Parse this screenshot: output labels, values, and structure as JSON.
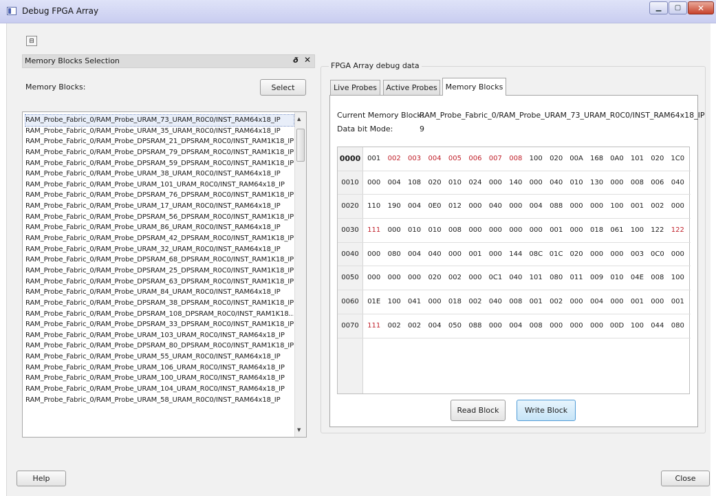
{
  "window": {
    "title": "Debug FPGA Array",
    "minimize_glyph": "▁",
    "maximize_glyph": "▢",
    "close_glyph": "✕"
  },
  "toolbar": {
    "toggle_glyph": "⊟"
  },
  "memory_selection": {
    "dock_title": "Memory Blocks Selection",
    "float_glyph": "ð",
    "close_glyph": "✕",
    "label": "Memory Blocks:",
    "select_button": "Select",
    "selected_index": 0,
    "items": [
      "RAM_Probe_Fabric_0/RAM_Probe_URAM_73_URAM_R0C0/INST_RAM64x18_IP",
      "RAM_Probe_Fabric_0/RAM_Probe_URAM_35_URAM_R0C0/INST_RAM64x18_IP",
      "RAM_Probe_Fabric_0/RAM_Probe_DPSRAM_21_DPSRAM_R0C0/INST_RAM1K18_IP",
      "RAM_Probe_Fabric_0/RAM_Probe_DPSRAM_79_DPSRAM_R0C0/INST_RAM1K18_IP",
      "RAM_Probe_Fabric_0/RAM_Probe_DPSRAM_59_DPSRAM_R0C0/INST_RAM1K18_IP",
      "RAM_Probe_Fabric_0/RAM_Probe_URAM_38_URAM_R0C0/INST_RAM64x18_IP",
      "RAM_Probe_Fabric_0/RAM_Probe_URAM_101_URAM_R0C0/INST_RAM64x18_IP",
      "RAM_Probe_Fabric_0/RAM_Probe_DPSRAM_76_DPSRAM_R0C0/INST_RAM1K18_IP",
      "RAM_Probe_Fabric_0/RAM_Probe_URAM_17_URAM_R0C0/INST_RAM64x18_IP",
      "RAM_Probe_Fabric_0/RAM_Probe_DPSRAM_56_DPSRAM_R0C0/INST_RAM1K18_IP",
      "RAM_Probe_Fabric_0/RAM_Probe_URAM_86_URAM_R0C0/INST_RAM64x18_IP",
      "RAM_Probe_Fabric_0/RAM_Probe_DPSRAM_42_DPSRAM_R0C0/INST_RAM1K18_IP",
      "RAM_Probe_Fabric_0/RAM_Probe_URAM_32_URAM_R0C0/INST_RAM64x18_IP",
      "RAM_Probe_Fabric_0/RAM_Probe_DPSRAM_68_DPSRAM_R0C0/INST_RAM1K18_IP",
      "RAM_Probe_Fabric_0/RAM_Probe_DPSRAM_25_DPSRAM_R0C0/INST_RAM1K18_IP",
      "RAM_Probe_Fabric_0/RAM_Probe_DPSRAM_63_DPSRAM_R0C0/INST_RAM1K18_IP",
      "RAM_Probe_Fabric_0/RAM_Probe_URAM_84_URAM_R0C0/INST_RAM64x18_IP",
      "RAM_Probe_Fabric_0/RAM_Probe_DPSRAM_38_DPSRAM_R0C0/INST_RAM1K18_IP",
      "RAM_Probe_Fabric_0/RAM_Probe_DPSRAM_108_DPSRAM_R0C0/INST_RAM1K18...",
      "RAM_Probe_Fabric_0/RAM_Probe_DPSRAM_33_DPSRAM_R0C0/INST_RAM1K18_IP",
      "RAM_Probe_Fabric_0/RAM_Probe_URAM_103_URAM_R0C0/INST_RAM64x18_IP",
      "RAM_Probe_Fabric_0/RAM_Probe_DPSRAM_80_DPSRAM_R0C0/INST_RAM1K18_IP",
      "RAM_Probe_Fabric_0/RAM_Probe_URAM_55_URAM_R0C0/INST_RAM64x18_IP",
      "RAM_Probe_Fabric_0/RAM_Probe_URAM_106_URAM_R0C0/INST_RAM64x18_IP",
      "RAM_Probe_Fabric_0/RAM_Probe_URAM_100_URAM_R0C0/INST_RAM64x18_IP",
      "RAM_Probe_Fabric_0/RAM_Probe_URAM_104_URAM_R0C0/INST_RAM64x18_IP",
      "RAM_Probe_Fabric_0/RAM_Probe_URAM_58_URAM_R0C0/INST_RAM64x18_IP"
    ]
  },
  "debug_data": {
    "group_title": "FPGA Array debug data",
    "tabs": [
      "Live Probes",
      "Active Probes",
      "Memory Blocks"
    ],
    "active_tab": "Memory Blocks",
    "current_block_label": "Current Memory Block:",
    "current_block_value": "RAM_Probe_Fabric_0/RAM_Probe_URAM_73_URAM_R0C0/INST_RAM64x18_IP",
    "data_bit_mode_label": "Data bit Mode:",
    "data_bit_mode_value": "9",
    "highlight_color": "#c0202a",
    "rows": [
      {
        "addr": "0000",
        "addr_bold": true,
        "cells": [
          "001",
          "002",
          "003",
          "004",
          "005",
          "006",
          "007",
          "008",
          "100",
          "020",
          "00A",
          "168",
          "0A0",
          "101",
          "020",
          "1C0"
        ],
        "red": [
          1,
          2,
          3,
          4,
          5,
          6,
          7
        ]
      },
      {
        "addr": "0010",
        "addr_bold": false,
        "cells": [
          "000",
          "004",
          "108",
          "020",
          "010",
          "024",
          "000",
          "140",
          "000",
          "040",
          "010",
          "130",
          "000",
          "008",
          "006",
          "040"
        ],
        "red": []
      },
      {
        "addr": "0020",
        "addr_bold": false,
        "cells": [
          "110",
          "190",
          "004",
          "0E0",
          "012",
          "000",
          "040",
          "000",
          "004",
          "088",
          "000",
          "000",
          "100",
          "001",
          "002",
          "000"
        ],
        "red": []
      },
      {
        "addr": "0030",
        "addr_bold": false,
        "cells": [
          "111",
          "000",
          "010",
          "010",
          "008",
          "000",
          "000",
          "000",
          "000",
          "001",
          "000",
          "018",
          "061",
          "100",
          "122",
          "122"
        ],
        "red": [
          0,
          15
        ]
      },
      {
        "addr": "0040",
        "addr_bold": false,
        "cells": [
          "000",
          "080",
          "004",
          "040",
          "000",
          "001",
          "000",
          "144",
          "08C",
          "01C",
          "020",
          "000",
          "000",
          "003",
          "0C0",
          "000"
        ],
        "red": []
      },
      {
        "addr": "0050",
        "addr_bold": false,
        "cells": [
          "000",
          "000",
          "000",
          "020",
          "002",
          "000",
          "0C1",
          "040",
          "101",
          "080",
          "011",
          "009",
          "010",
          "04E",
          "008",
          "100"
        ],
        "red": []
      },
      {
        "addr": "0060",
        "addr_bold": false,
        "cells": [
          "01E",
          "100",
          "041",
          "000",
          "018",
          "002",
          "040",
          "008",
          "001",
          "002",
          "000",
          "004",
          "000",
          "001",
          "000",
          "001"
        ],
        "red": []
      },
      {
        "addr": "0070",
        "addr_bold": false,
        "cells": [
          "111",
          "002",
          "002",
          "004",
          "050",
          "088",
          "000",
          "004",
          "008",
          "000",
          "000",
          "000",
          "00D",
          "100",
          "044",
          "080"
        ],
        "red": [
          0
        ]
      }
    ],
    "read_button": "Read Block",
    "write_button": "Write Block"
  },
  "footer": {
    "help_button": "Help",
    "close_button": "Close"
  }
}
